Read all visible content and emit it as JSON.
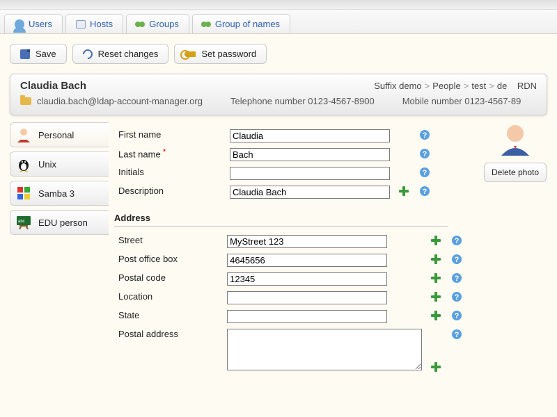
{
  "nav": {
    "tabs": [
      {
        "label": "Users",
        "icon": "user"
      },
      {
        "label": "Hosts",
        "icon": "host"
      },
      {
        "label": "Groups",
        "icon": "group"
      },
      {
        "label": "Group of names",
        "icon": "group"
      }
    ]
  },
  "toolbar": {
    "save": "Save",
    "reset": "Reset changes",
    "setpw": "Set password"
  },
  "header": {
    "title": "Claudia Bach",
    "suffix_label": "Suffix",
    "suffix_parts": [
      "demo",
      "People",
      "test",
      "de"
    ],
    "rdn": "RDN",
    "email": "claudia.bach@ldap-account-manager.org",
    "tel_label": "Telephone number",
    "tel": "0123-4567-8900",
    "mob_label": "Mobile number",
    "mob": "0123-4567-89"
  },
  "sidebar": {
    "items": [
      {
        "label": "Personal",
        "active": true,
        "icon": "person"
      },
      {
        "label": "Unix",
        "active": false,
        "icon": "tux"
      },
      {
        "label": "Samba 3",
        "active": false,
        "icon": "win"
      },
      {
        "label": "EDU person",
        "active": false,
        "icon": "board"
      }
    ]
  },
  "form": {
    "first_name": {
      "label": "First name",
      "value": "Claudia"
    },
    "last_name": {
      "label": "Last name",
      "value": "Bach",
      "required": true
    },
    "initials": {
      "label": "Initials",
      "value": ""
    },
    "description": {
      "label": "Description",
      "value": "Claudia Bach",
      "multi": true
    },
    "section_address": "Address",
    "street": {
      "label": "Street",
      "value": "MyStreet 123",
      "multi": true
    },
    "pobox": {
      "label": "Post office box",
      "value": "4645656",
      "multi": true
    },
    "postal": {
      "label": "Postal code",
      "value": "12345",
      "multi": true
    },
    "location": {
      "label": "Location",
      "value": "",
      "multi": true
    },
    "state": {
      "label": "State",
      "value": "",
      "multi": true
    },
    "postal_addr": {
      "label": "Postal address",
      "value": "",
      "textarea": true,
      "multi": true
    }
  },
  "photo": {
    "delete": "Delete photo"
  }
}
